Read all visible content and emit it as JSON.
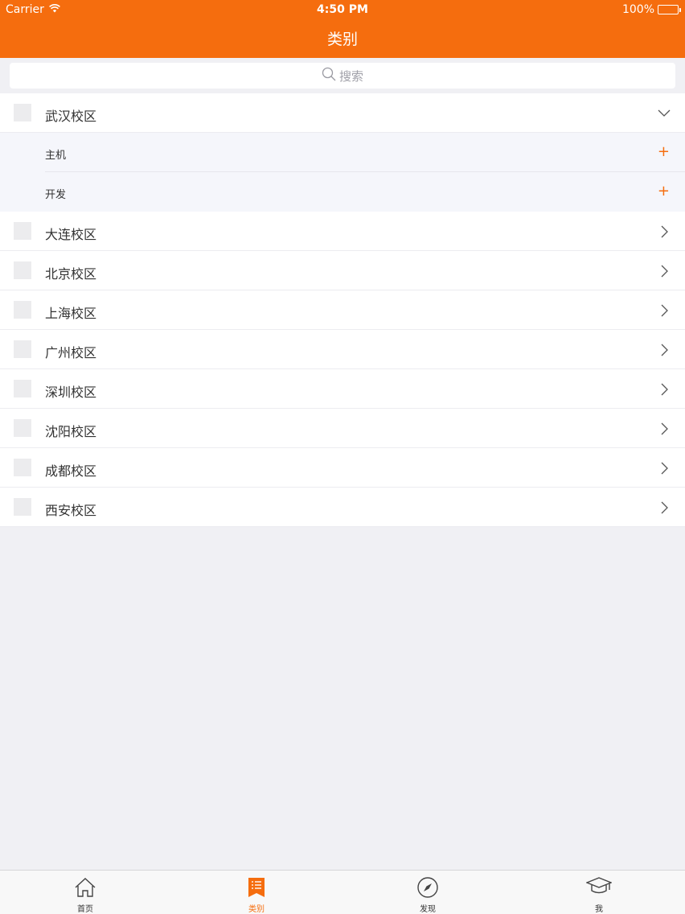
{
  "status_bar": {
    "carrier": "Carrier",
    "time": "4:50 PM",
    "battery": "100%"
  },
  "nav": {
    "title": "类别"
  },
  "search": {
    "placeholder": "搜索"
  },
  "categories": [
    {
      "label": "武汉校区",
      "expanded": true,
      "children": [
        "主机",
        "开发"
      ]
    },
    {
      "label": "大连校区"
    },
    {
      "label": "北京校区"
    },
    {
      "label": "上海校区"
    },
    {
      "label": "广州校区"
    },
    {
      "label": "深圳校区"
    },
    {
      "label": "沈阳校区"
    },
    {
      "label": "成都校区"
    },
    {
      "label": "西安校区"
    }
  ],
  "tabbar": {
    "items": [
      {
        "label": "首页",
        "icon": "home-icon"
      },
      {
        "label": "类别",
        "icon": "list-icon",
        "active": true
      },
      {
        "label": "发现",
        "icon": "compass-icon"
      },
      {
        "label": "我",
        "icon": "graduation-cap-icon"
      }
    ]
  },
  "colors": {
    "accent": "#f56d0e",
    "background": "#f0f0f4"
  }
}
